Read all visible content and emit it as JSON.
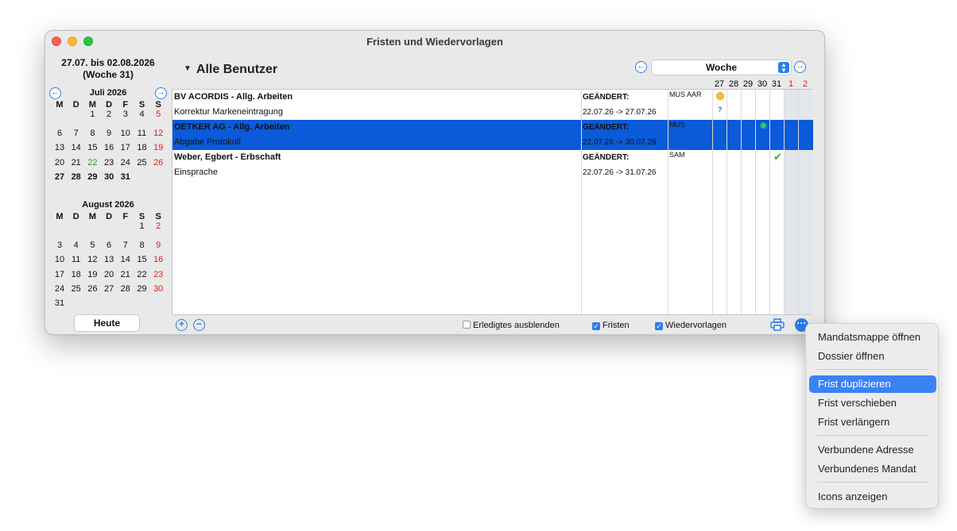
{
  "window": {
    "title": "Fristen und Wiedervorlagen"
  },
  "sidebar": {
    "range_line1": "27.07. bis 02.08.2026",
    "range_line2": "(Woche 31)",
    "weekday_headers": [
      "M",
      "D",
      "M",
      "D",
      "F",
      "S",
      "S"
    ],
    "july": {
      "title": "Juli 2026",
      "weeks": [
        [
          "",
          "",
          "1",
          "2",
          "3",
          "4",
          "5"
        ],
        [
          "6",
          "7",
          "8",
          "9",
          "10",
          "11",
          "12"
        ],
        [
          "13",
          "14",
          "15",
          "16",
          "17",
          "18",
          "19"
        ],
        [
          "20",
          "21",
          "22",
          "23",
          "24",
          "25",
          "26"
        ],
        [
          "27",
          "28",
          "29",
          "30",
          "31",
          "",
          ""
        ]
      ]
    },
    "august": {
      "title": "August 2026",
      "weeks": [
        [
          "",
          "",
          "",
          "",
          "",
          "1",
          "2"
        ],
        [
          "3",
          "4",
          "5",
          "6",
          "7",
          "8",
          "9"
        ],
        [
          "10",
          "11",
          "12",
          "13",
          "14",
          "15",
          "16"
        ],
        [
          "17",
          "18",
          "19",
          "20",
          "21",
          "22",
          "23"
        ],
        [
          "24",
          "25",
          "26",
          "27",
          "28",
          "29",
          "30"
        ],
        [
          "31",
          "",
          "",
          "",
          "",
          "",
          ""
        ]
      ]
    },
    "today_button": "Heute"
  },
  "toolbar": {
    "user_filter": "Alle Benutzer",
    "period": "Woche",
    "day_columns": [
      "27",
      "28",
      "29",
      "30",
      "31",
      "1",
      "2"
    ],
    "weekend_color": "#e0201b"
  },
  "rows": [
    {
      "title": "BV ACORDIS - Allg. Arbeiten",
      "status": "GEÄNDERT:",
      "user": "MUS AAR",
      "subtitle": "Korrektur Markeneintragung",
      "dates": "22.07.26 -> 27.07.26",
      "selected": false,
      "icon": "yellow-dot-icon",
      "icon2": "?"
    },
    {
      "title": "OETKER AG - Allg. Arbeiten",
      "status": "GEÄNDERT:",
      "user": "MUS",
      "subtitle": "Abgabe Protokoll",
      "dates": "22.07.26 -> 30.07.26",
      "selected": true,
      "icon": "green-star-icon"
    },
    {
      "title": "Weber, Egbert - Erbschaft",
      "status": "GEÄNDERT:",
      "user": "SAM",
      "subtitle": "Einsprache",
      "dates": "22.07.26 -> 31.07.26",
      "selected": false,
      "icon": "check-icon"
    }
  ],
  "bottom": {
    "hide_done": "Erledigtes ausblenden",
    "deadlines": "Fristen",
    "resubmissions": "Wiedervorlagen"
  },
  "menu": {
    "items": [
      "Mandatsmappe öffnen",
      "Dossier öffnen",
      "Frist duplizieren",
      "Frist verschieben",
      "Frist verlängern",
      "Verbundene Adresse",
      "Verbundenes Mandat",
      "Icons anzeigen"
    ],
    "highlighted": "Frist duplizieren"
  }
}
